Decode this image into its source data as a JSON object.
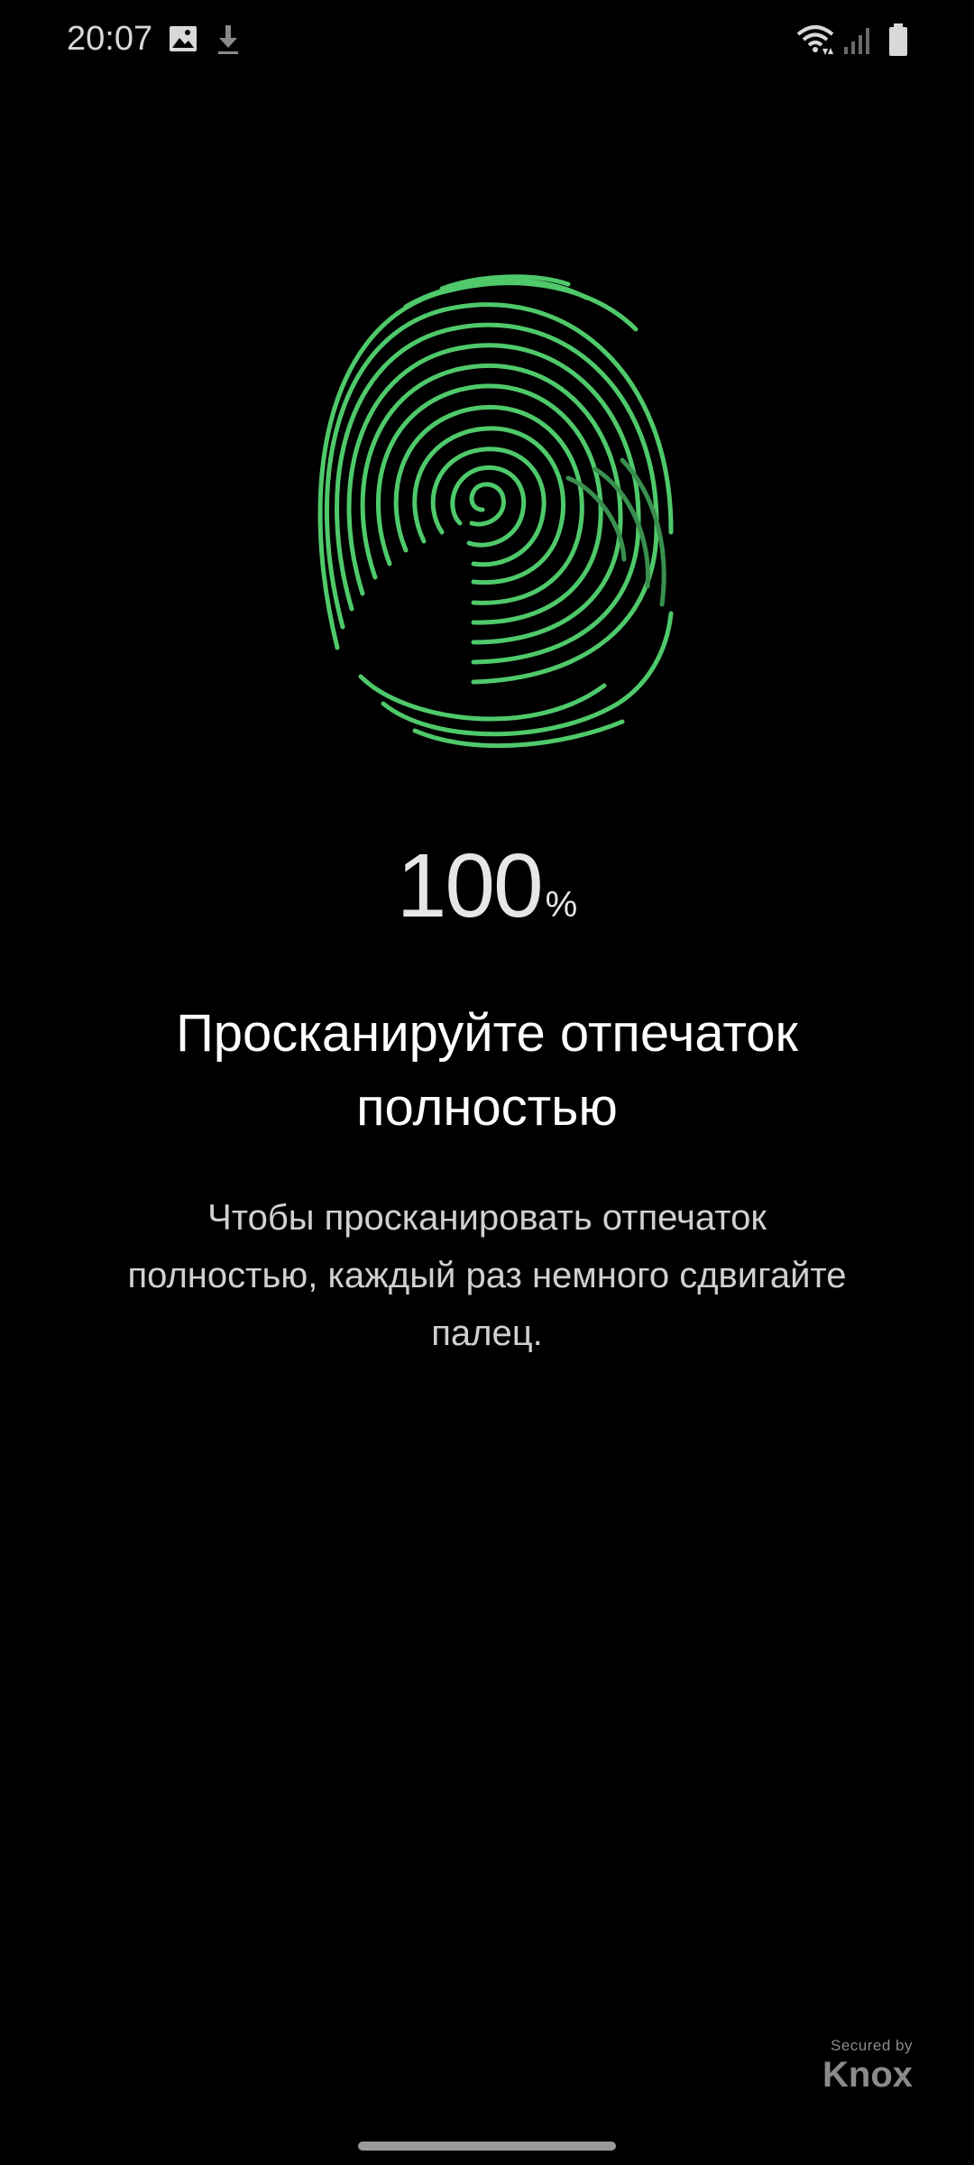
{
  "status_bar": {
    "time": "20:07",
    "icons": [
      "image-icon",
      "download-icon",
      "wifi-icon",
      "signal-icon",
      "battery-icon"
    ]
  },
  "fingerprint": {
    "icon": "fingerprint-icon",
    "color": "#4fc96a",
    "progress_percent": 100
  },
  "progress": {
    "value": "100",
    "unit": "%"
  },
  "title": {
    "line1": "Просканируйте отпечаток",
    "line2": "полностью"
  },
  "description": {
    "line1": "Чтобы просканировать отпечаток",
    "line2": "полностью, каждый раз немного сдвигайте",
    "line3": "палец."
  },
  "knox": {
    "secured_by": "Secured by",
    "brand": "Knox"
  }
}
